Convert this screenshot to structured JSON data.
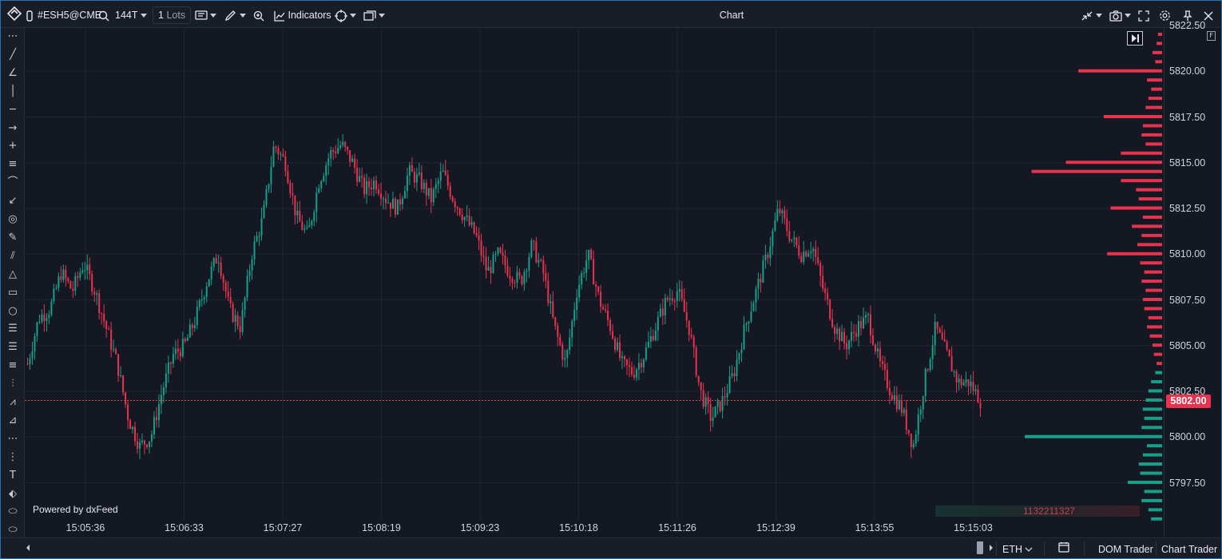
{
  "toolbar": {
    "symbol": "#ESH5@CME",
    "interval": "144T",
    "lots_value": "1",
    "lots_unit": "Lots",
    "indicators_label": "Indicators",
    "window_title": "Chart"
  },
  "left_tools": [
    "dots-handle",
    "line-tool",
    "angle-tool",
    "vertical-line-tool",
    "horizontal-line-tool",
    "arrow-tool",
    "crosshair-tool",
    "parallel-lines-tool",
    "curve-tool",
    "pitchfork-tool",
    "spiral-tool",
    "ruler-tool",
    "hatch-tool",
    "triangle-tool",
    "rectangle-tool",
    "ellipse-tool",
    "fib-retracement-tool",
    "fib-extension-tool",
    "fib-time-tool",
    "fib-fan-tool",
    "gann-tool",
    "regression-tool",
    "dotted-rect-tool",
    "dotted-vertical-tool",
    "text-tool",
    "tag-tool",
    "label-tool",
    "price-label-tool"
  ],
  "chart_data": {
    "type": "candlestick",
    "symbol": "#ESH5@CME",
    "ylim": [
      5795.0,
      5822.5
    ],
    "y_ticks": [
      "5797.50",
      "5800.00",
      "5802.50",
      "5805.00",
      "5807.50",
      "5810.00",
      "5812.50",
      "5815.00",
      "5817.50",
      "5820.00"
    ],
    "y_top_partial": "5822.50",
    "current_price": "5802.00",
    "x_ticks": [
      "15:05:36",
      "15:06:33",
      "15:07:27",
      "15:08:19",
      "15:09:23",
      "15:10:18",
      "15:11:26",
      "15:12:39",
      "15:13:55",
      "15:15:03"
    ],
    "price_path": [
      5804,
      5806.5,
      5807,
      5809,
      5808,
      5809.5,
      5808,
      5806,
      5804,
      5801,
      5799.5,
      5800,
      5802.5,
      5804.5,
      5805,
      5806.5,
      5808.5,
      5810,
      5807,
      5806,
      5810,
      5812,
      5816,
      5815,
      5812,
      5811,
      5814,
      5815.5,
      5816,
      5815,
      5813.5,
      5814,
      5813,
      5812.5,
      5814.5,
      5814,
      5813,
      5814.5,
      5813,
      5812,
      5811,
      5809,
      5810,
      5809,
      5808.5,
      5810.5,
      5809,
      5806,
      5804,
      5808,
      5810,
      5807.5,
      5806,
      5804,
      5803.5,
      5804.5,
      5806,
      5807.5,
      5808,
      5806,
      5802.5,
      5801,
      5802,
      5803.5,
      5806,
      5808,
      5810,
      5812.5,
      5811,
      5810,
      5810.5,
      5808,
      5806,
      5805,
      5806,
      5806.5,
      5804,
      5802.5,
      5801.5,
      5799.5,
      5803,
      5806,
      5804.5,
      5803,
      5803,
      5802
    ],
    "volume_profile": {
      "ask_levels": [
        5803.5,
        5804,
        5804.5,
        5805,
        5805.5,
        5806,
        5806.5,
        5807,
        5807.5,
        5808,
        5808.5,
        5809,
        5809.5,
        5810,
        5810.5,
        5811,
        5811.5,
        5812,
        5812.5,
        5813,
        5813.5,
        5814,
        5814.5,
        5815,
        5815.5,
        5816,
        5816.5,
        5817,
        5817.5,
        5818,
        5818.5,
        5819,
        5819.5,
        5820,
        5820.5,
        5821,
        5821.5,
        5822
      ],
      "ask_volumes": [
        4,
        8,
        12,
        14,
        18,
        22,
        20,
        26,
        28,
        24,
        30,
        26,
        32,
        80,
        36,
        30,
        44,
        28,
        75,
        34,
        38,
        60,
        190,
        140,
        60,
        24,
        30,
        28,
        85,
        24,
        20,
        16,
        22,
        122,
        10,
        14,
        8,
        6
      ],
      "bid_levels": [
        5795.5,
        5796,
        5796.5,
        5797,
        5797.5,
        5798,
        5798.5,
        5799,
        5799.5,
        5800,
        5800.5,
        5801,
        5801.5,
        5802,
        5802.5,
        5803,
        5803.5
      ],
      "bid_volumes": [
        16,
        20,
        30,
        26,
        50,
        32,
        34,
        28,
        22,
        200,
        30,
        26,
        28,
        24,
        20,
        16,
        10
      ],
      "ask_color": "#e8334f",
      "bid_color": "#16a08a",
      "total_volume": "1132211327"
    },
    "up_color": "#16a08a",
    "down_color": "#e8334f"
  },
  "powered_by": "Powered by dxFeed",
  "bottom": {
    "session": "ETH",
    "dom_trader": "DOM Trader",
    "chart_trader": "Chart Trader"
  },
  "colors": {
    "background": "#131823",
    "grid": "#1f2531",
    "accent_border": "#2a6fb0"
  }
}
